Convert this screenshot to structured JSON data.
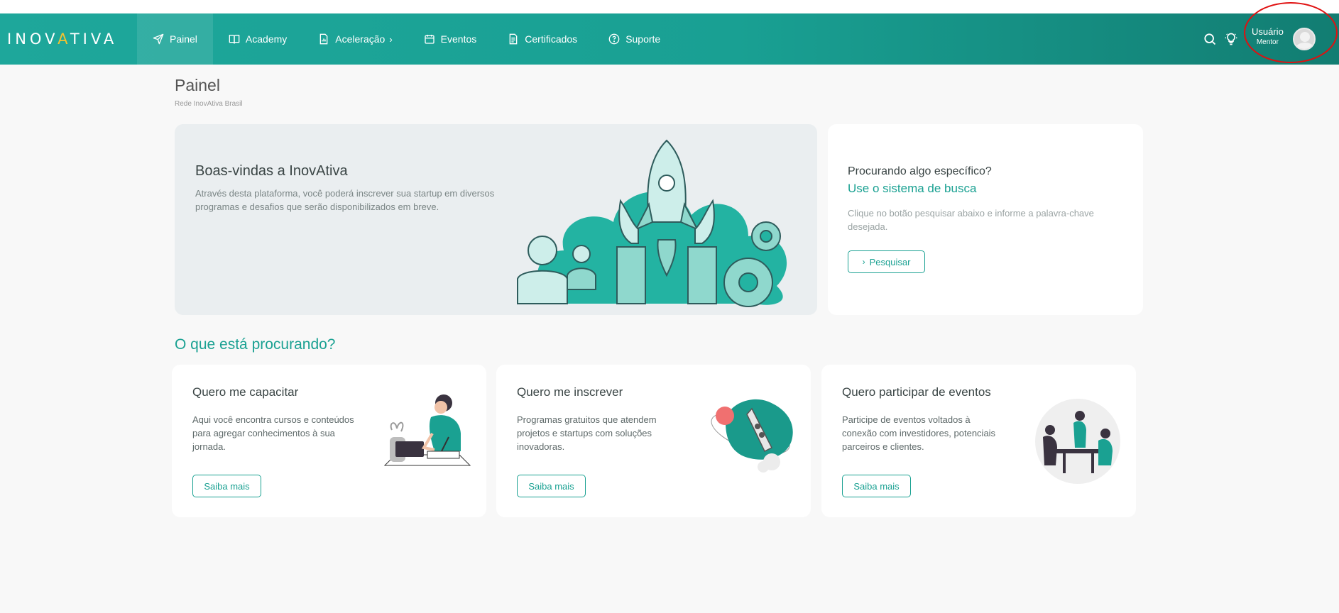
{
  "brand": {
    "logo_text_a": "INOV",
    "logo_text_accent": "A",
    "logo_text_b": "TIVA"
  },
  "nav": {
    "items": [
      {
        "label": "Painel",
        "icon": "send-icon",
        "active": true
      },
      {
        "label": "Academy",
        "icon": "book-icon"
      },
      {
        "label": "Aceleração",
        "icon": "chart-doc-icon",
        "chevron": "›"
      },
      {
        "label": "Eventos",
        "icon": "calendar-icon"
      },
      {
        "label": "Certificados",
        "icon": "document-icon"
      },
      {
        "label": "Suporte",
        "icon": "help-circle-icon"
      }
    ],
    "search_icon": "search-icon",
    "idea_icon": "lightbulb-icon",
    "user": {
      "name": "Usuário",
      "role": "Mentor"
    }
  },
  "page": {
    "title": "Painel",
    "subtitle": "Rede InovAtiva Brasil"
  },
  "hero": {
    "title": "Boas-vindas a InovAtiva",
    "text": "Através desta plataforma, você poderá inscrever sua startup em diversos programas e desafios que serão disponibilizados em breve."
  },
  "search_card": {
    "question": "Procurando algo específico?",
    "cta_text": "Use o sistema de busca",
    "description": "Clique no botão pesquisar abaixo e informe a palavra-chave desejada.",
    "button_label": "Pesquisar"
  },
  "section": {
    "title": "O que está procurando?"
  },
  "cards": [
    {
      "title": "Quero me capacitar",
      "text": "Aqui você encontra cursos e conteúdos para agregar conhecimentos à sua jornada.",
      "button_label": "Saiba mais"
    },
    {
      "title": "Quero me inscrever",
      "text": "Programas gratuitos que atendem projetos e startups com soluções inovadoras.",
      "button_label": "Saiba mais"
    },
    {
      "title": "Quero participar de eventos",
      "text": "Participe de eventos voltados à conexão com investidores, potenciais parceiros e clientes.",
      "button_label": "Saiba mais"
    }
  ],
  "colors": {
    "primary": "#1aa192",
    "nav_dark": "#127d72",
    "accent_logo": "#f2c230",
    "highlight_circle": "#e01010"
  }
}
